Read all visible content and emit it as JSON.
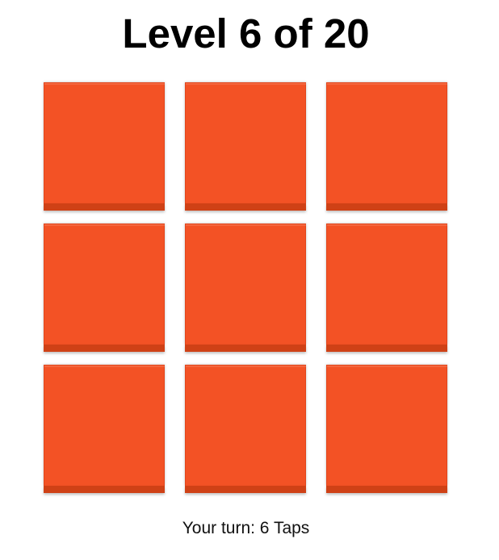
{
  "header": {
    "title": "Level 6 of 20"
  },
  "board": {
    "tile_color": "#f35225",
    "tile_edge_color": "#cf4116",
    "tiles": [
      {
        "row": 1,
        "col": 1,
        "state": "unlit"
      },
      {
        "row": 1,
        "col": 2,
        "state": "unlit"
      },
      {
        "row": 1,
        "col": 3,
        "state": "unlit"
      },
      {
        "row": 2,
        "col": 1,
        "state": "unlit"
      },
      {
        "row": 2,
        "col": 2,
        "state": "unlit"
      },
      {
        "row": 2,
        "col": 3,
        "state": "unlit"
      },
      {
        "row": 3,
        "col": 1,
        "state": "unlit"
      },
      {
        "row": 3,
        "col": 2,
        "state": "unlit"
      },
      {
        "row": 3,
        "col": 3,
        "state": "unlit"
      }
    ]
  },
  "footer": {
    "status": "Your turn: 6 Taps"
  }
}
